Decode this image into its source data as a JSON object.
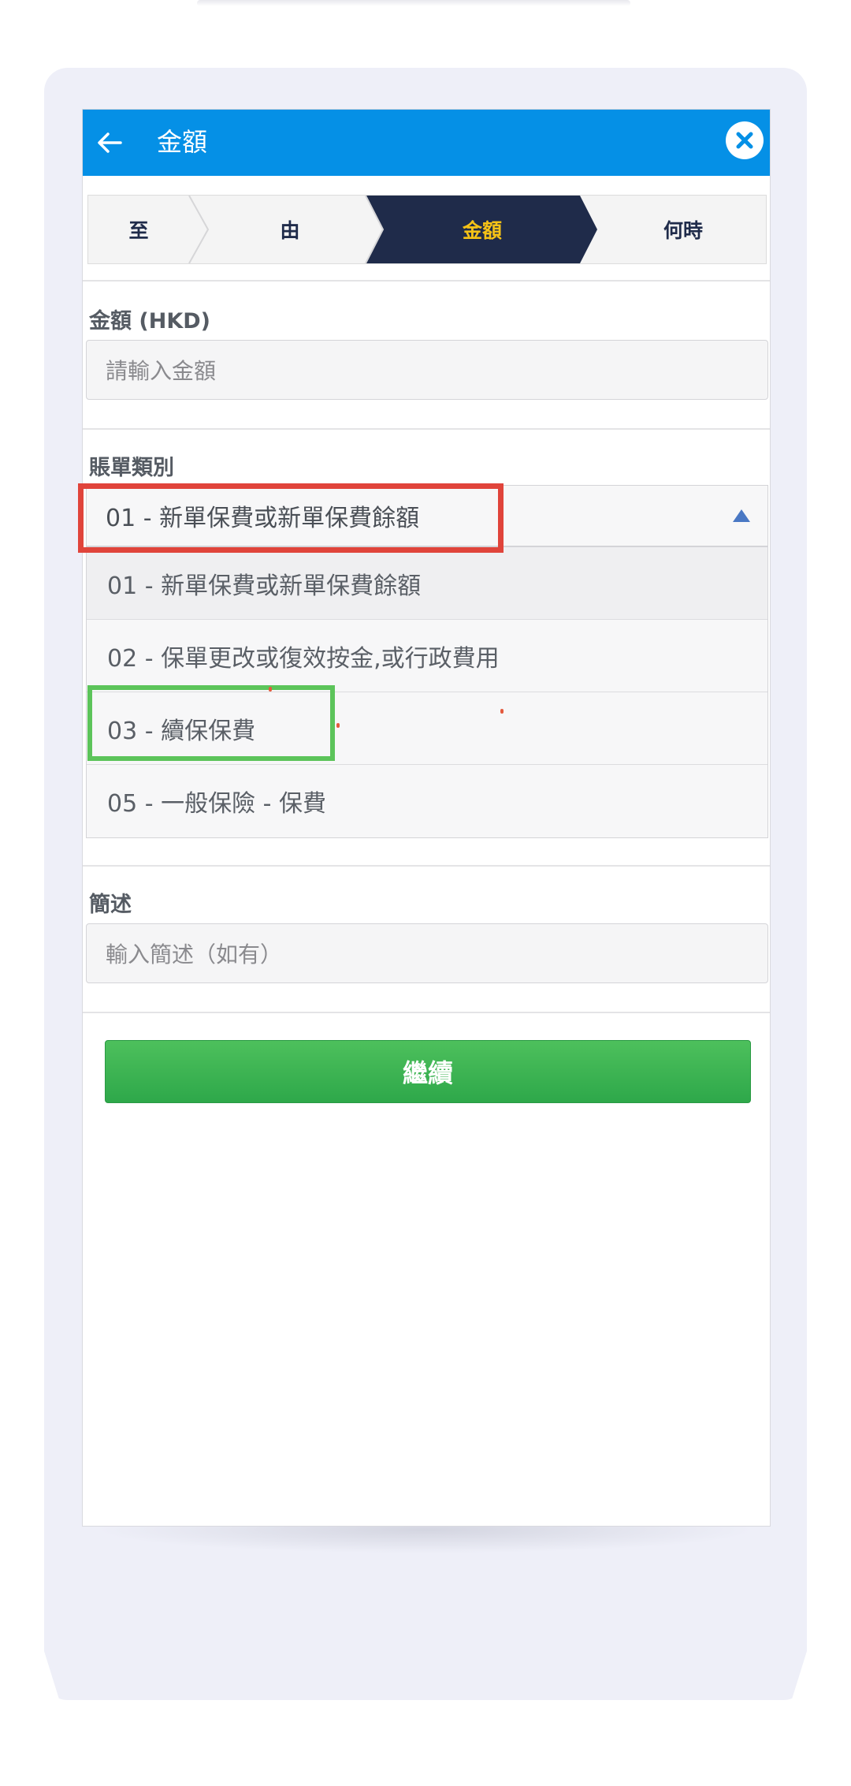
{
  "header": {
    "title": "金額",
    "back_icon": "arrow-left-icon",
    "close_icon": "close-icon"
  },
  "steps": [
    {
      "label": "至",
      "active": false
    },
    {
      "label": "由",
      "active": false
    },
    {
      "label": "金額",
      "active": true
    },
    {
      "label": "何時",
      "active": false
    }
  ],
  "amount": {
    "label": "金額 (HKD)",
    "placeholder": "請輸入金額",
    "value": ""
  },
  "bill_type": {
    "label": "賬單類別",
    "selected": "01 - 新單保費或新單保費餘額",
    "options": [
      "01 - 新單保費或新單保費餘額",
      "02 - 保單更改或復效按金,或行政費用",
      "03 - 續保保費",
      "05 - 一般保險 - 保費"
    ]
  },
  "description": {
    "label": "簡述",
    "placeholder": "輸入簡述（如有）",
    "value": ""
  },
  "continue_label": "繼續",
  "colors": {
    "header_blue": "#0590e6",
    "active_step": "#1f2b4a",
    "active_step_text": "#f5c216",
    "continue_green": "#3db552",
    "highlight_red": "#e0443b",
    "highlight_green": "#5cc45a"
  }
}
